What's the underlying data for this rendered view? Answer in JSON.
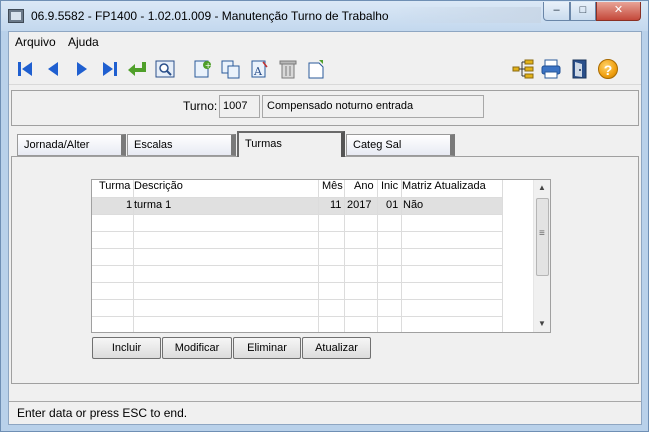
{
  "window": {
    "title": "06.9.5582 - FP1400 - 1.02.01.009 - Manutenção Turno de Trabalho",
    "min_glyph": "–",
    "max_glyph": "□",
    "close_glyph": "✕"
  },
  "menu": {
    "items": [
      {
        "label": "Arquivo"
      },
      {
        "label": "Ajuda"
      }
    ]
  },
  "toolbar": {
    "icons": [
      "first-record-icon",
      "previous-record-icon",
      "next-record-icon",
      "last-record-icon",
      "select-record-icon",
      "search-icon",
      "new-record-icon",
      "copy-record-icon",
      "edit-text-icon",
      "delete-icon",
      "blank-record-icon",
      "tree-structure-icon",
      "print-icon",
      "exit-icon",
      "help-icon"
    ],
    "help_glyph": "?"
  },
  "header": {
    "turno_label": "Turno:",
    "turno_code": "1007",
    "turno_desc": "Compensado noturno entrada"
  },
  "tabs": [
    {
      "label": "Jornada/Alter"
    },
    {
      "label": "Escalas"
    },
    {
      "label": "Turmas"
    },
    {
      "label": "Categ Sal"
    }
  ],
  "grid": {
    "columns": [
      "Turma",
      "Descrição",
      "Mês",
      "Ano",
      "Inic",
      "Matriz Atualizada"
    ],
    "rows": [
      {
        "turma": "1",
        "descricao": "turma 1",
        "mes": "11",
        "ano": "2017",
        "inic": "01",
        "matriz": "Não"
      }
    ]
  },
  "buttons": {
    "incluir": "Incluir",
    "modificar": "Modificar",
    "eliminar": "Eliminar",
    "atualizar": "Atualizar"
  },
  "status": {
    "text": "Enter data or press ESC to end."
  },
  "colors": {
    "nav_blue": "#1f5fd0",
    "help_orange": "#f0a010",
    "select_green": "#4f9f2a"
  }
}
